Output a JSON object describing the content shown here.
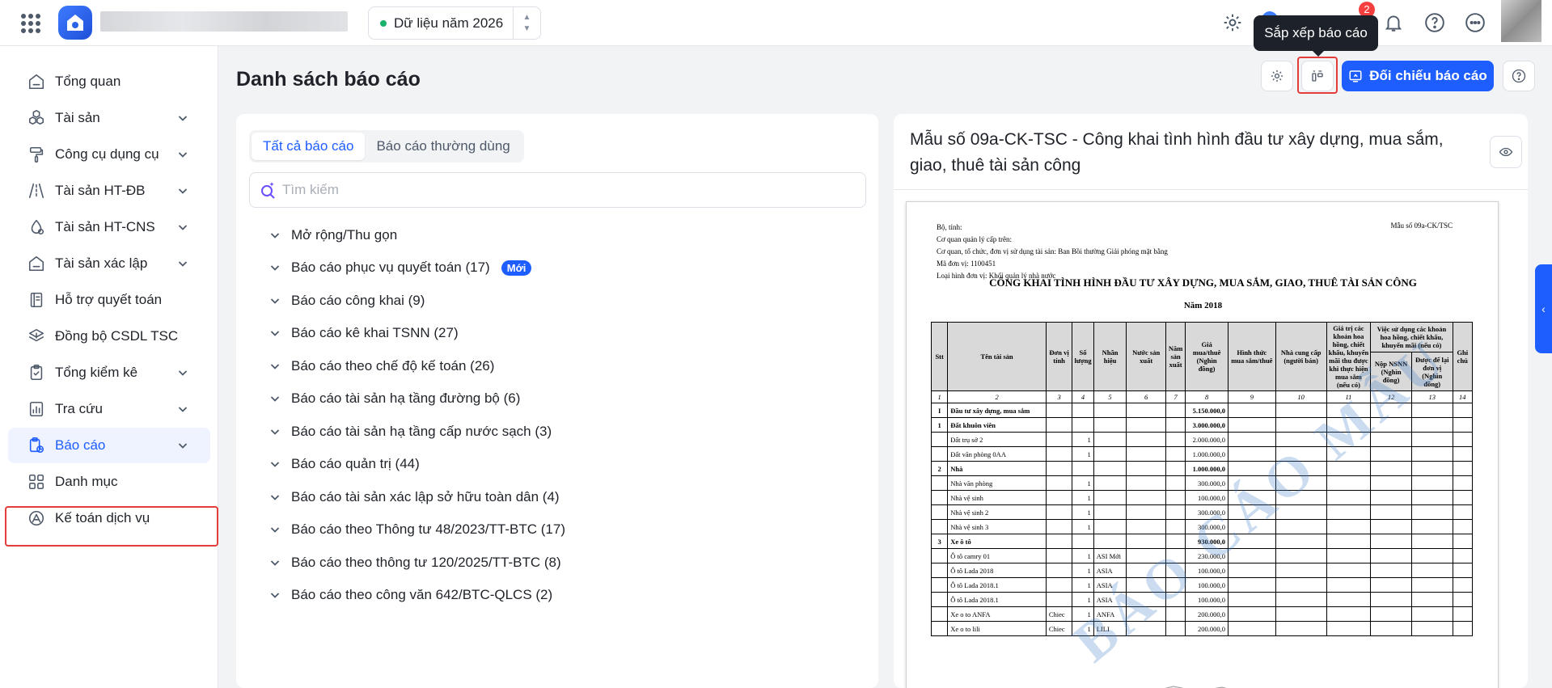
{
  "header": {
    "year_selector": "Dữ liệu năm 2026",
    "notification_count": "2",
    "tooltip": "Sắp xếp báo cáo"
  },
  "sidebar": {
    "items": [
      {
        "label": "Tổng quan",
        "icon": "home-icon",
        "has_children": false
      },
      {
        "label": "Tài sản",
        "icon": "cubes-icon",
        "has_children": true
      },
      {
        "label": "Công cụ dụng cụ",
        "icon": "paint-roller-icon",
        "has_children": true
      },
      {
        "label": "Tài sản HT-ĐB",
        "icon": "road-icon",
        "has_children": true
      },
      {
        "label": "Tài sản HT-CNS",
        "icon": "water-drop-icon",
        "has_children": true
      },
      {
        "label": "Tài sản xác lập",
        "icon": "home-icon",
        "has_children": true
      },
      {
        "label": "Hỗ trợ quyết toán",
        "icon": "book-icon",
        "has_children": false
      },
      {
        "label": "Đồng bộ CSDL TSC",
        "icon": "sync-layers-icon",
        "has_children": false
      },
      {
        "label": "Tổng kiểm kê",
        "icon": "clipboard-icon",
        "has_children": true
      },
      {
        "label": "Tra cứu",
        "icon": "chart-doc-icon",
        "has_children": true
      },
      {
        "label": "Báo cáo",
        "icon": "report-icon",
        "has_children": true,
        "active": true
      },
      {
        "label": "Danh mục",
        "icon": "grid-icon",
        "has_children": false
      },
      {
        "label": "Kế toán dịch vụ",
        "icon": "accounting-icon",
        "has_children": false
      }
    ]
  },
  "main": {
    "title": "Danh sách báo cáo",
    "compare_button": "Đối chiếu báo cáo",
    "tabs": [
      "Tất cả báo cáo",
      "Báo cáo thường dùng"
    ],
    "search_placeholder": "Tìm kiếm",
    "tree": [
      {
        "label": "Mở rộng/Thu gọn"
      },
      {
        "label": "Báo cáo phục vụ quyết toán (17)",
        "badge": "Mới"
      },
      {
        "label": "Báo cáo công khai (9)"
      },
      {
        "label": "Báo cáo kê khai TSNN (27)"
      },
      {
        "label": "Báo cáo theo chế độ kế toán (26)"
      },
      {
        "label": "Báo cáo tài sản hạ tầng đường bộ (6)"
      },
      {
        "label": "Báo cáo tài sản hạ tầng cấp nước sạch (3)"
      },
      {
        "label": "Báo cáo quản trị (44)"
      },
      {
        "label": "Báo cáo tài sản xác lập sở hữu toàn dân (4)"
      },
      {
        "label": "Báo cáo theo Thông tư 48/2023/TT-BTC (17)"
      },
      {
        "label": "Báo cáo theo thông tư 120/2025/TT-BTC (8)"
      },
      {
        "label": "Báo cáo theo công văn 642/BTC-QLCS (2)"
      }
    ]
  },
  "preview": {
    "title": "Mẫu số 09a-CK-TSC - Công khai tình hình đầu tư xây dựng, mua sắm, giao, thuê tài sản công",
    "doc": {
      "meta": [
        "Bộ, tỉnh:",
        "Cơ quan quản lý cấp trên:",
        "Cơ quan, tổ chức, đơn vị sử dụng tài sản: Ban Bồi thường Giải phóng mặt bằng",
        "Mã đơn vị: 1100451",
        "Loại hình đơn vị: Khối quản lý nhà nước"
      ],
      "form_no": "Mẫu số 09a-CK/TSC",
      "title": "CÔNG KHAI TÌNH HÌNH ĐẦU TƯ XÂY DỰNG, MUA SẮM, GIAO, THUÊ TÀI SẢN CÔNG",
      "year": "Năm 2018",
      "watermark": "BÁO CÁO MẪU",
      "headers": {
        "stt": "Stt",
        "name": "Tên tài sản",
        "unit": "Đơn vị tính",
        "qty": "Số lượng",
        "brand": "Nhãn hiệu",
        "origin": "Nước sản xuất",
        "year": "Năm sản xuất",
        "price": "Giá mua/thuê (Nghìn đồng)",
        "method": "Hình thức mua sắm/thuê",
        "supplier": "Nhà cung cấp (người bán)",
        "discount": "Giá trị các khoản hoa hồng, chiết khấu, khuyến mãi thu được khi thực hiện mua sắm (nếu có)",
        "usage": "Việc sử dụng các khoản hoa hồng, chiết khấu, khuyến mãi (nếu có)",
        "nsnn": "Nộp NSNN (Nghìn đồng)",
        "retain": "Được để lại đơn vị (Nghìn đồng)",
        "note": "Ghi chú"
      },
      "col_numbers": [
        "1",
        "2",
        "3",
        "4",
        "5",
        "6",
        "7",
        "8",
        "9",
        "10",
        "11",
        "12",
        "13",
        "14"
      ],
      "rows": [
        {
          "stt": "I",
          "name": "Đầu tư xây dựng, mua sắm",
          "unit": "",
          "qty": "",
          "brand": "",
          "price": "5.150.000,0",
          "bold": true
        },
        {
          "stt": "1",
          "name": "Đất khuôn viên",
          "unit": "",
          "qty": "",
          "brand": "",
          "price": "3.000.000,0",
          "bold": true
        },
        {
          "stt": "",
          "name": "Đất trụ sở 2",
          "unit": "",
          "qty": "1",
          "brand": "",
          "price": "2.000.000,0"
        },
        {
          "stt": "",
          "name": "Đất văn phòng 0AA",
          "unit": "",
          "qty": "1",
          "brand": "",
          "price": "1.000.000,0"
        },
        {
          "stt": "2",
          "name": "Nhà",
          "unit": "",
          "qty": "",
          "brand": "",
          "price": "1.000.000,0",
          "bold": true
        },
        {
          "stt": "",
          "name": "Nhà văn phòng",
          "unit": "",
          "qty": "1",
          "brand": "",
          "price": "300.000,0"
        },
        {
          "stt": "",
          "name": "Nhà vệ sinh",
          "unit": "",
          "qty": "1",
          "brand": "",
          "price": "100.000,0"
        },
        {
          "stt": "",
          "name": "Nhà vệ sinh 2",
          "unit": "",
          "qty": "1",
          "brand": "",
          "price": "300.000,0"
        },
        {
          "stt": "",
          "name": "Nhà vệ sinh 3",
          "unit": "",
          "qty": "1",
          "brand": "",
          "price": "300.000,0"
        },
        {
          "stt": "3",
          "name": "Xe ô tô",
          "unit": "",
          "qty": "",
          "brand": "",
          "price": "930.000,0",
          "bold": true
        },
        {
          "stt": "",
          "name": "Ô tô camry 01",
          "unit": "",
          "qty": "1",
          "brand": "ASI Mới",
          "price": "230.000,0"
        },
        {
          "stt": "",
          "name": "Ô tô Lada 2018",
          "unit": "",
          "qty": "1",
          "brand": "ASIA",
          "price": "100.000,0"
        },
        {
          "stt": "",
          "name": "Ô tô Lada 2018.1",
          "unit": "",
          "qty": "1",
          "brand": "ASIA",
          "price": "100.000,0"
        },
        {
          "stt": "",
          "name": "Ô tô Lada 2018.1",
          "unit": "",
          "qty": "1",
          "brand": "ASIA",
          "price": "100.000,0"
        },
        {
          "stt": "",
          "name": "Xe o to ANFA",
          "unit": "Chiec",
          "qty": "1",
          "brand": "ANFA",
          "price": "200.000,0"
        },
        {
          "stt": "",
          "name": "Xe o to lili",
          "unit": "Chiec",
          "qty": "1",
          "brand": "LILI",
          "price": "200.000,0"
        }
      ]
    }
  }
}
